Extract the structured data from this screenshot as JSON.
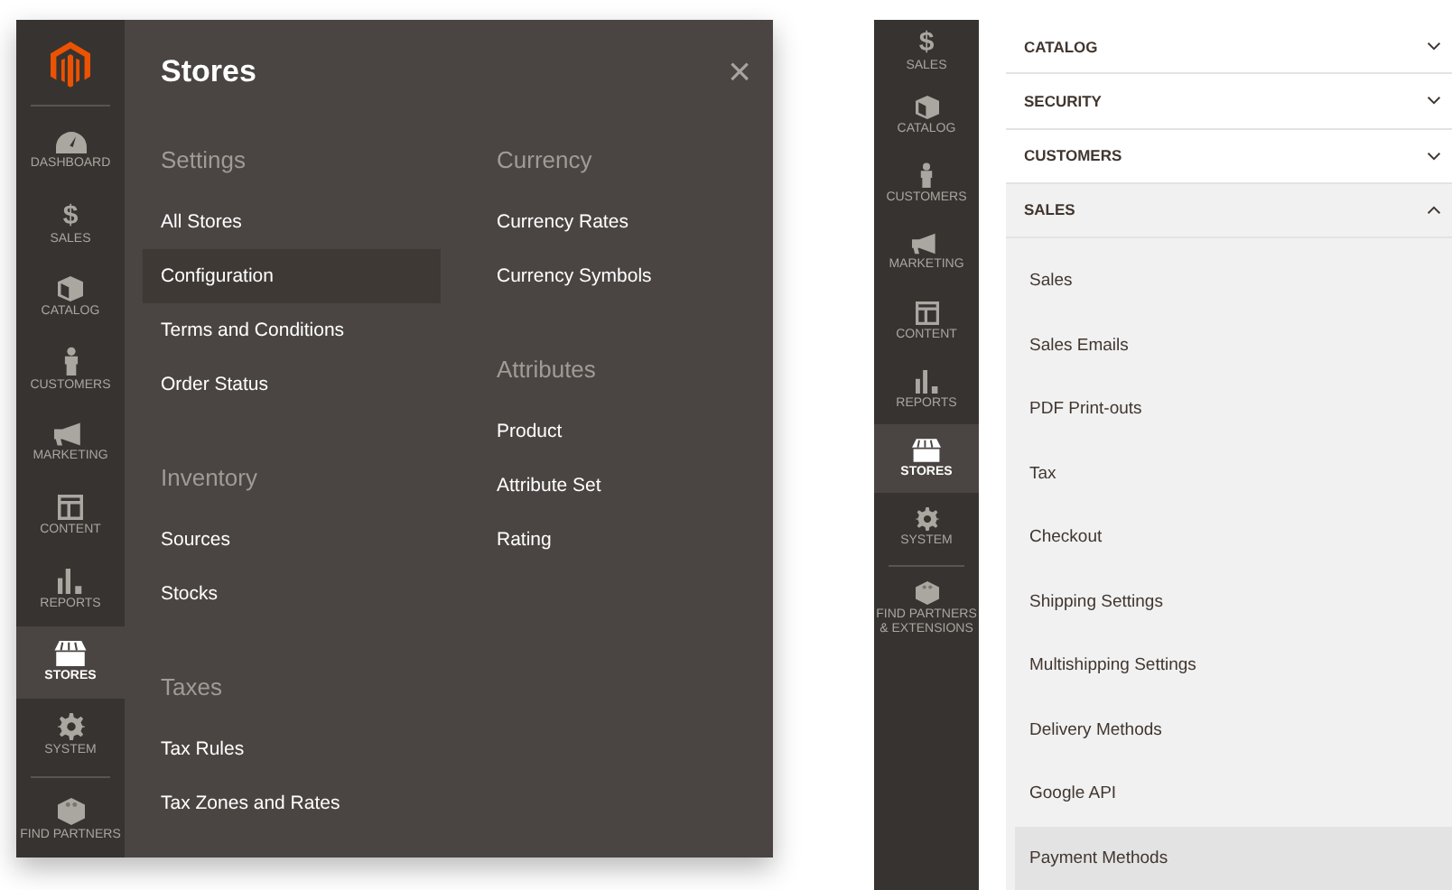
{
  "left_panel": {
    "sidebar": [
      {
        "kind": "dashboard",
        "label": "DASHBOARD",
        "selected": false
      },
      {
        "kind": "sales",
        "glyph": "$",
        "label": "SALES",
        "selected": false
      },
      {
        "kind": "catalog",
        "label": "CATALOG",
        "selected": false
      },
      {
        "kind": "customers",
        "label": "CUSTOMERS",
        "selected": false
      },
      {
        "kind": "marketing",
        "label": "MARKETING",
        "selected": false
      },
      {
        "kind": "content",
        "label": "CONTENT",
        "selected": false
      },
      {
        "kind": "reports",
        "label": "REPORTS",
        "selected": false
      },
      {
        "kind": "stores",
        "label": "STORES",
        "selected": true
      },
      {
        "kind": "system",
        "label": "SYSTEM",
        "selected": false
      },
      {
        "kind": "partners",
        "label": "FIND PARTNERS",
        "selected": false
      }
    ],
    "flyout": {
      "title": "Stores",
      "close": "×",
      "columns": [
        {
          "groups": [
            {
              "heading": "Settings",
              "items": [
                {
                  "label": "All Stores",
                  "selected": false
                },
                {
                  "label": "Configuration",
                  "selected": true
                },
                {
                  "label": "Terms and Conditions",
                  "selected": false
                },
                {
                  "label": "Order Status",
                  "selected": false
                }
              ]
            },
            {
              "heading": "Inventory",
              "items": [
                {
                  "label": "Sources",
                  "selected": false
                },
                {
                  "label": "Stocks",
                  "selected": false
                }
              ]
            },
            {
              "heading": "Taxes",
              "items": [
                {
                  "label": "Tax Rules",
                  "selected": false
                },
                {
                  "label": "Tax Zones and Rates",
                  "selected": false
                }
              ]
            }
          ]
        },
        {
          "groups": [
            {
              "heading": "Currency",
              "items": [
                {
                  "label": "Currency Rates",
                  "selected": false
                },
                {
                  "label": "Currency Symbols",
                  "selected": false
                }
              ]
            },
            {
              "heading": "Attributes",
              "items": [
                {
                  "label": "Product",
                  "selected": false
                },
                {
                  "label": "Attribute Set",
                  "selected": false
                },
                {
                  "label": "Rating",
                  "selected": false
                }
              ]
            }
          ]
        }
      ]
    }
  },
  "right_panel": {
    "sidebar": [
      {
        "kind": "sales",
        "glyph": "$",
        "label": "SALES",
        "selected": false
      },
      {
        "kind": "catalog",
        "label": "CATALOG",
        "selected": false
      },
      {
        "kind": "customers",
        "label": "CUSTOMERS",
        "selected": false
      },
      {
        "kind": "marketing",
        "label": "MARKETING",
        "selected": false
      },
      {
        "kind": "content",
        "label": "CONTENT",
        "selected": false
      },
      {
        "kind": "reports",
        "label": "REPORTS",
        "selected": false
      },
      {
        "kind": "stores",
        "label": "STORES",
        "selected": true
      },
      {
        "kind": "system",
        "label": "SYSTEM",
        "selected": false
      },
      {
        "kind": "partners",
        "label": "FIND PARTNERS & EXTENSIONS",
        "selected": false
      }
    ],
    "sections": [
      {
        "title": "CATALOG",
        "expanded": false
      },
      {
        "title": "SECURITY",
        "expanded": false
      },
      {
        "title": "CUSTOMERS",
        "expanded": false
      },
      {
        "title": "SALES",
        "expanded": true,
        "items": [
          {
            "label": "Sales",
            "selected": false
          },
          {
            "label": "Sales Emails",
            "selected": false
          },
          {
            "label": "PDF Print-outs",
            "selected": false
          },
          {
            "label": "Tax",
            "selected": false
          },
          {
            "label": "Checkout",
            "selected": false
          },
          {
            "label": "Shipping Settings",
            "selected": false
          },
          {
            "label": "Multishipping Settings",
            "selected": false
          },
          {
            "label": "Delivery Methods",
            "selected": false
          },
          {
            "label": "Google API",
            "selected": false
          },
          {
            "label": "Payment Methods",
            "selected": true
          }
        ]
      }
    ]
  }
}
